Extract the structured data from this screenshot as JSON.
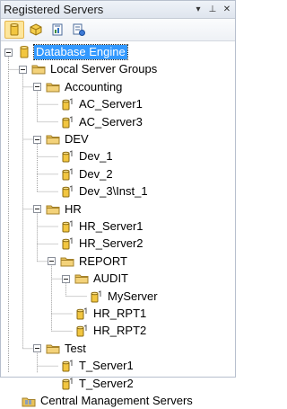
{
  "window": {
    "title": "Registered Servers",
    "dropdown_glyph": "▾",
    "pin_glyph": "⊥",
    "close_glyph": "✕"
  },
  "toolbar": {
    "tools": [
      {
        "name": "database-engine-tool",
        "icon": "database-engine-icon",
        "active": true
      },
      {
        "name": "analysis-services-tool",
        "icon": "analysis-services-cube-icon",
        "active": false
      },
      {
        "name": "reporting-services-tool",
        "icon": "reporting-services-icon",
        "active": false
      },
      {
        "name": "integration-services-tool",
        "icon": "integration-services-icon",
        "active": false
      }
    ]
  },
  "tree": {
    "nodes": [
      {
        "label": "Database Engine",
        "depth": 0,
        "kind": "engine",
        "expander": true,
        "selected": true
      },
      {
        "label": "Local Server Groups",
        "depth": 1,
        "kind": "folder",
        "expander": true
      },
      {
        "label": "Accounting",
        "depth": 2,
        "kind": "folder",
        "expander": true
      },
      {
        "label": "AC_Server1",
        "depth": 3,
        "kind": "server"
      },
      {
        "label": "AC_Server3",
        "depth": 3,
        "kind": "server"
      },
      {
        "label": "DEV",
        "depth": 2,
        "kind": "folder",
        "expander": true
      },
      {
        "label": "Dev_1",
        "depth": 3,
        "kind": "server"
      },
      {
        "label": "Dev_2",
        "depth": 3,
        "kind": "server"
      },
      {
        "label": "Dev_3\\Inst_1",
        "depth": 3,
        "kind": "server"
      },
      {
        "label": "HR",
        "depth": 2,
        "kind": "folder",
        "expander": true
      },
      {
        "label": "HR_Server1",
        "depth": 3,
        "kind": "server"
      },
      {
        "label": "HR_Server2",
        "depth": 3,
        "kind": "server"
      },
      {
        "label": "REPORT",
        "depth": 3,
        "kind": "folder",
        "expander": true
      },
      {
        "label": "AUDIT",
        "depth": 4,
        "kind": "folder",
        "expander": true
      },
      {
        "label": "MyServer",
        "depth": 5,
        "kind": "server"
      },
      {
        "label": "HR_RPT1",
        "depth": 4,
        "kind": "server"
      },
      {
        "label": "HR_RPT2",
        "depth": 4,
        "kind": "server"
      },
      {
        "label": "Test",
        "depth": 2,
        "kind": "folder",
        "expander": true
      },
      {
        "label": "T_Server1",
        "depth": 3,
        "kind": "server"
      },
      {
        "label": "T_Server2",
        "depth": 3,
        "kind": "server"
      },
      {
        "label": "Central Management Servers",
        "depth": 1,
        "kind": "central",
        "expander": false
      }
    ]
  },
  "colors": {
    "selection": "#3399ff",
    "folder": "#e8c15a",
    "server_can": "#f2c640",
    "tree_lines": "#a0a0a0"
  }
}
